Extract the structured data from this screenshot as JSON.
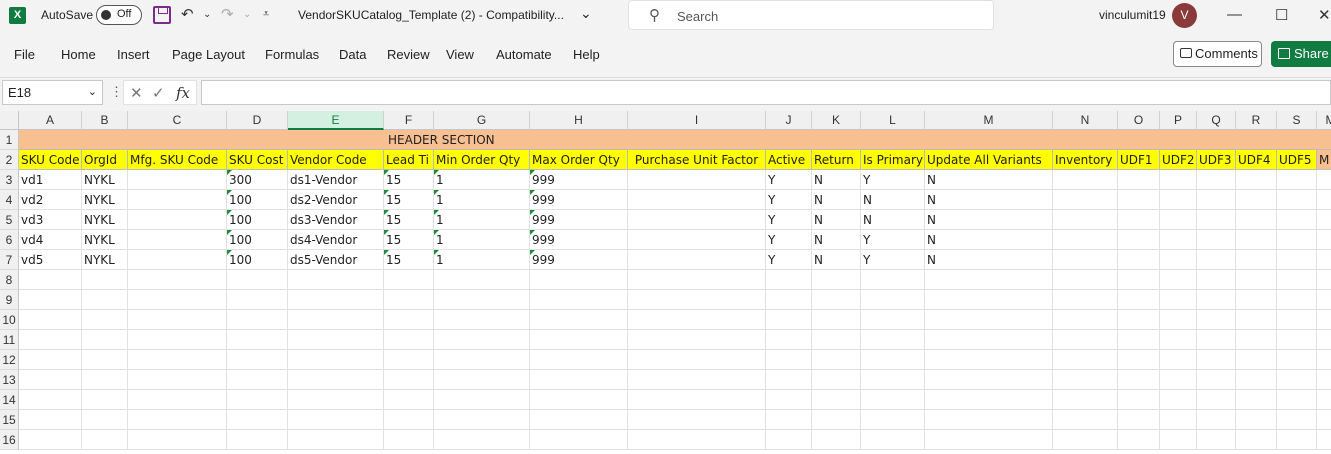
{
  "titlebar": {
    "app_logo": "X",
    "autosave_label": "AutoSave",
    "autosave_state": "Off",
    "doc_title": "VendorSKUCatalog_Template (2)  -  Compatibility...",
    "search_placeholder": "Search",
    "username": "vinculumit19",
    "avatar_initial": "V"
  },
  "ribbon": {
    "tabs": [
      "File",
      "Home",
      "Insert",
      "Page Layout",
      "Formulas",
      "Data",
      "Review",
      "View",
      "Automate",
      "Help"
    ],
    "comments_label": "Comments",
    "share_label": "Share"
  },
  "formula_bar": {
    "name_box": "E18",
    "formula": ""
  },
  "sheet": {
    "columns": [
      "A",
      "B",
      "C",
      "D",
      "E",
      "F",
      "G",
      "H",
      "I",
      "J",
      "K",
      "L",
      "M",
      "N",
      "O",
      "P",
      "Q",
      "R",
      "S",
      "M"
    ],
    "selected_column": "E",
    "row_numbers": [
      "1",
      "2",
      "3",
      "4",
      "5",
      "6",
      "7",
      "8",
      "9",
      "10",
      "11",
      "12",
      "13",
      "14",
      "15",
      "16"
    ],
    "header_section_label": "HEADER SECTION",
    "header_row": [
      "SKU Code",
      "OrgId",
      "Mfg. SKU Code",
      "SKU Cost",
      "Vendor Code",
      "Lead Ti",
      "Min Order Qty",
      "Max Order Qty",
      "Purchase Unit Factor",
      "Active",
      "Return",
      "Is Primary",
      "Update All Variants",
      "Inventory",
      "UDF1",
      "UDF2",
      "UDF3",
      "UDF4",
      "UDF5",
      "M"
    ],
    "data_rows": [
      [
        "vd1",
        "NYKL",
        "",
        "300",
        "ds1-Vendor",
        "15",
        "1",
        "999",
        "",
        "Y",
        "N",
        "Y",
        "N",
        "",
        "",
        "",
        "",
        "",
        "",
        ""
      ],
      [
        "vd2",
        "NYKL",
        "",
        "100",
        "ds2-Vendor",
        "15",
        "1",
        "999",
        "",
        "Y",
        "N",
        "N",
        "N",
        "",
        "",
        "",
        "",
        "",
        "",
        ""
      ],
      [
        "vd3",
        "NYKL",
        "",
        "100",
        "ds3-Vendor",
        "15",
        "1",
        "999",
        "",
        "Y",
        "N",
        "N",
        "N",
        "",
        "",
        "",
        "",
        "",
        "",
        ""
      ],
      [
        "vd4",
        "NYKL",
        "",
        "100",
        "ds4-Vendor",
        "15",
        "1",
        "999",
        "",
        "Y",
        "N",
        "Y",
        "N",
        "",
        "",
        "",
        "",
        "",
        "",
        ""
      ],
      [
        "vd5",
        "NYKL",
        "",
        "100",
        "ds5-Vendor",
        "15",
        "1",
        "999",
        "",
        "Y",
        "N",
        "Y",
        "N",
        "",
        "",
        "",
        "",
        "",
        "",
        ""
      ]
    ],
    "colors": {
      "header_section": "#f8bf90",
      "header_row": "#ffff00",
      "accent": "#107c41"
    }
  }
}
